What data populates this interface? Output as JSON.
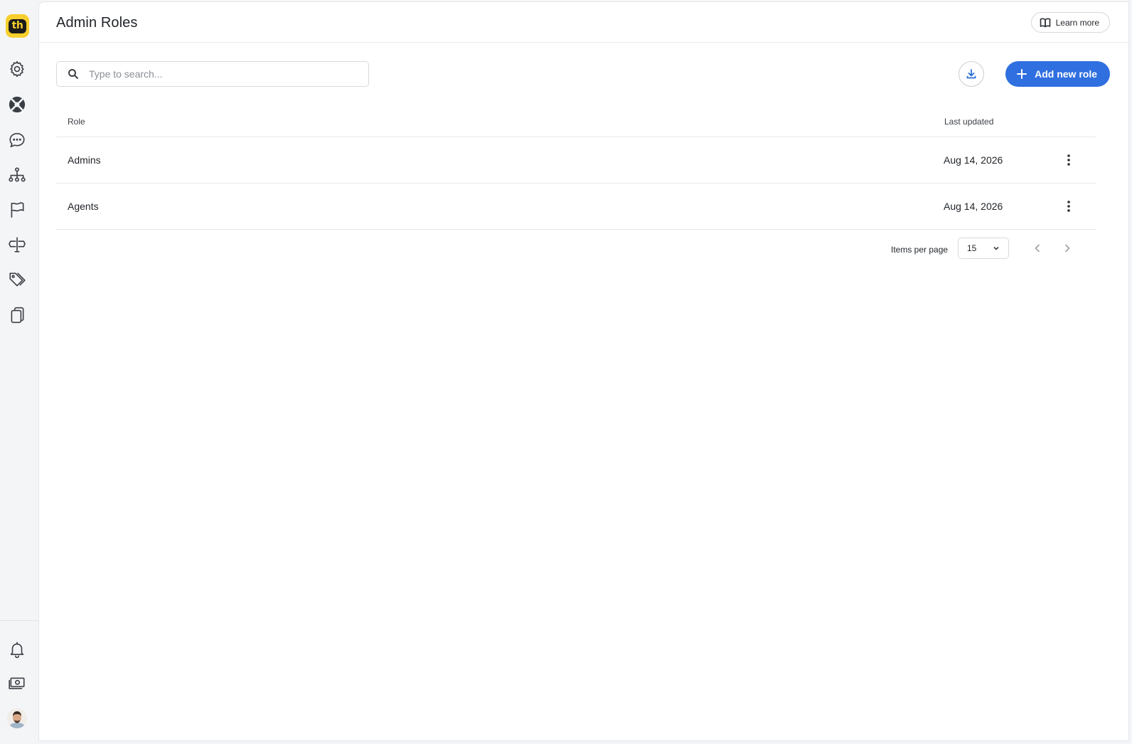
{
  "brand": {
    "logo_text": "th",
    "color": "#f7cf2e"
  },
  "sidebar": {
    "items": [
      {
        "name": "settings",
        "icon": "gear-icon"
      },
      {
        "name": "help",
        "icon": "lifebuoy-icon"
      },
      {
        "name": "chat",
        "icon": "chat-bubble-icon"
      },
      {
        "name": "hierarchy",
        "icon": "org-chart-icon"
      },
      {
        "name": "flags",
        "icon": "flag-icon"
      },
      {
        "name": "signpost",
        "icon": "signpost-icon"
      },
      {
        "name": "tags",
        "icon": "tags-icon"
      },
      {
        "name": "pages",
        "icon": "pages-icon"
      }
    ],
    "bottom_items": [
      {
        "name": "notifications",
        "icon": "bell-icon"
      },
      {
        "name": "billing",
        "icon": "money-icon"
      },
      {
        "name": "profile",
        "icon": "avatar"
      }
    ]
  },
  "header": {
    "title": "Admin Roles",
    "learn_more_label": "Learn more"
  },
  "toolbar": {
    "search_placeholder": "Type to search...",
    "add_label": "Add new role",
    "accent_color": "#2f6fe0"
  },
  "table": {
    "columns": [
      "Role",
      "Last updated"
    ],
    "rows": [
      {
        "role": "Admins",
        "last_updated": "Aug 14, 2026"
      },
      {
        "role": "Agents",
        "last_updated": "Aug 14, 2026"
      }
    ]
  },
  "pagination": {
    "items_per_page_label": "Items per page",
    "items_per_page_value": "15"
  }
}
